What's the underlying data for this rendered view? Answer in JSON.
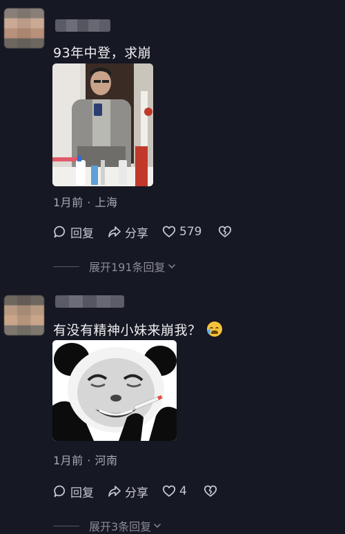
{
  "comments": [
    {
      "text": "93年中登，求崩",
      "meta": "1月前 · 上海",
      "reply_label": "回复",
      "share_label": "分享",
      "likes": "579",
      "expand_label": "展开191条回复"
    },
    {
      "text": "有没有精神小妹来崩我？",
      "meta": "1月前 · 河南",
      "reply_label": "回复",
      "share_label": "分享",
      "likes": "4",
      "expand_label": "展开3条回复"
    }
  ],
  "colors": {
    "background": "#161823",
    "text": "#eeeef0",
    "muted": "#a9aab2",
    "emoji": "#f6c23c"
  }
}
